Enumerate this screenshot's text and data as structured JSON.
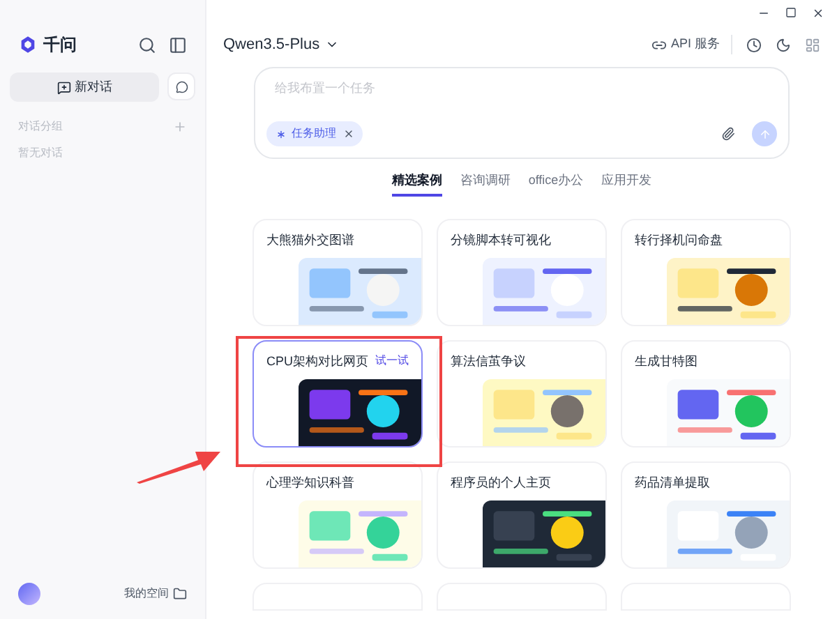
{
  "sidebar": {
    "brand": "千问",
    "new_chat": "新对话",
    "group_label": "对话分组",
    "empty_text": "暂无对话",
    "space_label": "我的空间"
  },
  "header": {
    "model": "Qwen3.5-Plus",
    "api_label": "API 服务"
  },
  "input": {
    "placeholder": "给我布置一个任务",
    "chip": "任务助理"
  },
  "tabs": [
    {
      "label": "精选案例",
      "selected": true
    },
    {
      "label": "咨询调研",
      "selected": false
    },
    {
      "label": "office办公",
      "selected": false
    },
    {
      "label": "应用开发",
      "selected": false
    }
  ],
  "cards": [
    {
      "title": "大熊猫外交图谱",
      "selected": false
    },
    {
      "title": "分镜脚本转可视化",
      "selected": false
    },
    {
      "title": "转行择机问命盘",
      "selected": false
    },
    {
      "title": "CPU架构对比网页",
      "selected": true,
      "action": "试一试"
    },
    {
      "title": "算法信茧争议",
      "selected": false
    },
    {
      "title": "生成甘特图",
      "selected": false
    },
    {
      "title": "心理学知识科普",
      "selected": false
    },
    {
      "title": "程序员的个人主页",
      "selected": false
    },
    {
      "title": "药品清单提取",
      "selected": false
    }
  ]
}
